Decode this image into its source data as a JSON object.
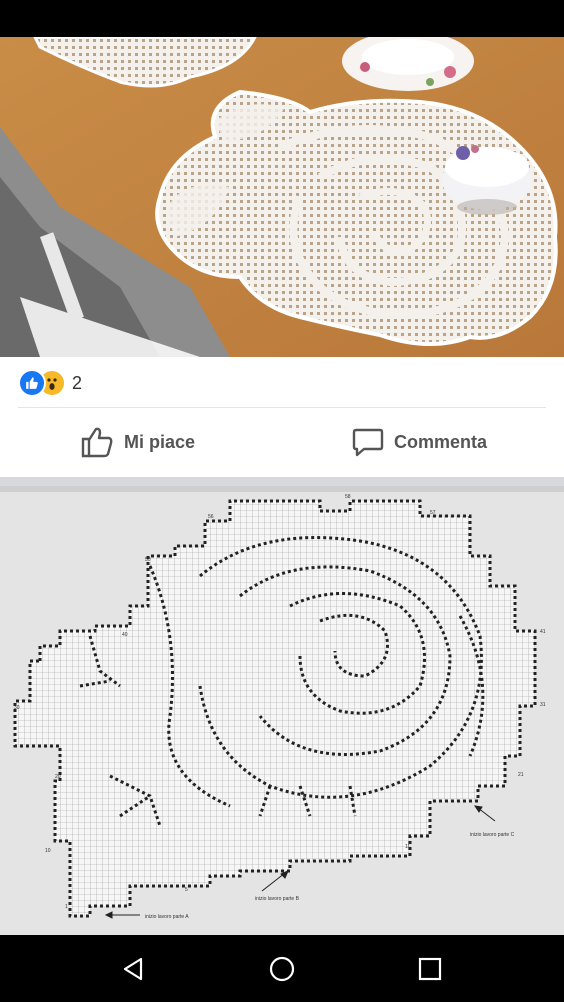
{
  "post": {
    "reactions": {
      "count": "2",
      "types": [
        "like-icon",
        "wow-icon"
      ]
    },
    "actions": {
      "like_label": "Mi piace",
      "comment_label": "Commenta"
    }
  },
  "pattern_labels": {
    "start_a": "inizio lavoro parte A",
    "start_b": "inizio lavoro parte B",
    "start_c": "inizio lavoro parte C",
    "row_numbers": [
      "56",
      "58",
      "57",
      "50",
      "40",
      "41",
      "30",
      "31",
      "20",
      "21",
      "10",
      "11",
      "1",
      "5"
    ]
  },
  "colors": {
    "like_blue": "#1877f2",
    "wow_yellow": "#f7b928",
    "wood": "#c68a43",
    "lace": "#f4f1ec"
  },
  "navigation": {
    "buttons": [
      "back-icon",
      "home-icon",
      "recents-icon"
    ]
  }
}
